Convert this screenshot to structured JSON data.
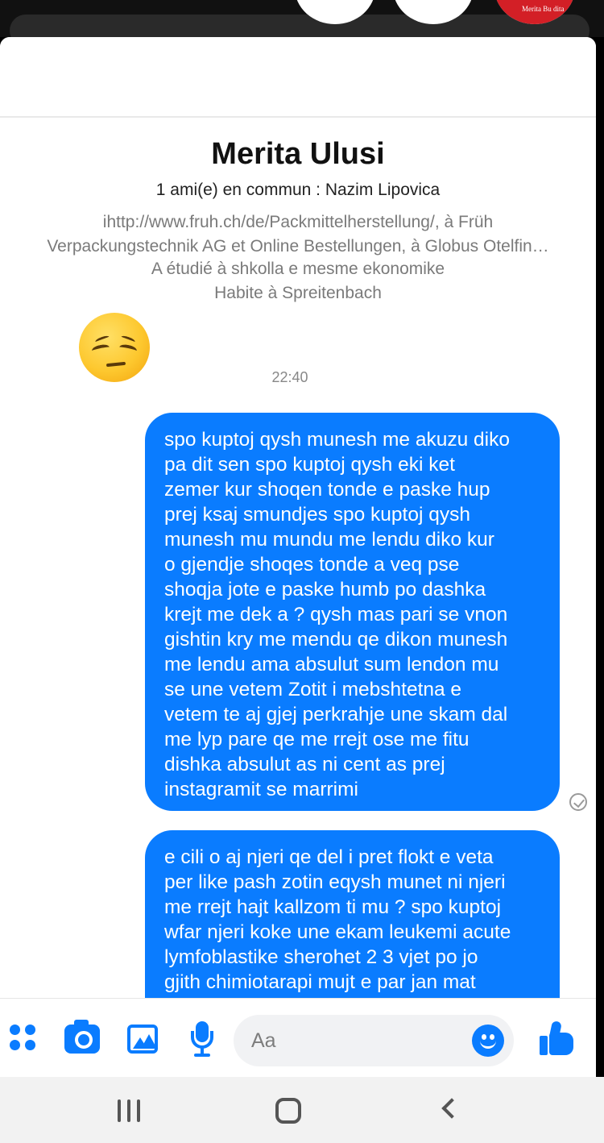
{
  "colors": {
    "accent": "#0a7cff",
    "bubble_text": "#ffffff",
    "secondary_text": "#7a7a7a"
  },
  "background": {
    "thumbnail_caption": "Merita Bu",
    "thumbnail_label": "dita"
  },
  "profile": {
    "name": "Merita Ulusi",
    "mutual_friends": "1 ami(e) en commun : Nazim Lipovica",
    "work_line_1": "ihttp://www.fruh.ch/de/Packmittelherstellung/, à Früh",
    "work_line_2": "Verpackungstechnik AG et Online Bestellungen, à Globus Otelfin…",
    "education": "A étudié à shkolla e mesme ekonomike",
    "lives_in": "Habite à Spreitenbach"
  },
  "conversation": {
    "received_emoji": "pensive-face",
    "timestamp": "22:40",
    "messages": [
      {
        "sender": "me",
        "text": "spo kuptoj qysh munesh me akuzu diko\npa dit sen spo kuptoj qysh eki ket\nzemer kur shoqen tonde e paske hup\nprej ksaj smundjes spo kuptoj qysh\nmunesh mu mundu me lendu diko kur\no gjendje shoqes tonde a veq pse\nshoqja jote e paske humb po dashka\nkrejt me dek a ?  qysh mas pari se vnon\ngishtin kry me mendu qe dikon munesh\nme lendu ama absulut sum lendon mu\nse une  vetem Zotit i mebshtetna  e\nvetem te aj gjej perkrahje une skam dal\nme lyp pare qe me rrejt ose me fitu\ndishka absulut as ni cent as prej\ninstagramit se marrimi",
        "status": "sent"
      },
      {
        "sender": "me",
        "text": "e cili o aj njeri qe del i pret flokt e veta\nper   like pash zotin eqysh munet ni njeri\nme rrejt hajt kallzom ti mu ? spo kuptoj\nwfar njeri koke une ekam leukemi acute\nlymfoblastike   sherohet 2 3 vjet po jo\ngjith chimiotarapi mujt e par jan mat"
      }
    ]
  },
  "composer": {
    "placeholder": "Aa",
    "icons": [
      "apps-icon",
      "camera-icon",
      "gallery-icon",
      "microphone-icon",
      "emoji-icon",
      "like-icon"
    ]
  },
  "system_nav": {
    "icons": [
      "recent-apps-icon",
      "home-icon",
      "back-icon"
    ]
  }
}
